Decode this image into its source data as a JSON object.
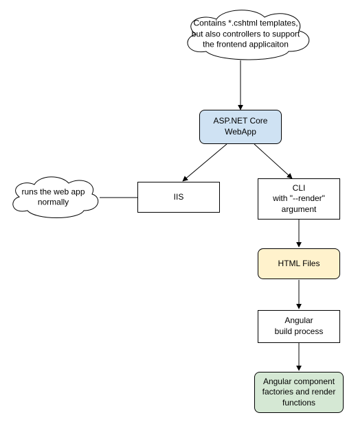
{
  "nodes": {
    "cloud_top": {
      "text": "Contains *.cshtml templates, but also controllers to support the frontend applicaiton"
    },
    "aspnet": {
      "text": "ASP.NET Core WebApp"
    },
    "iis": {
      "text": "IIS"
    },
    "cloud_left": {
      "text": "runs the web app normally"
    },
    "cli": {
      "text": "CLI\nwith \"--render\" argument"
    },
    "html_files": {
      "text": "HTML Files"
    },
    "angular_build": {
      "text": "Angular\nbuild process"
    },
    "angular_comp": {
      "text": "Angular component factories and render functions"
    }
  }
}
